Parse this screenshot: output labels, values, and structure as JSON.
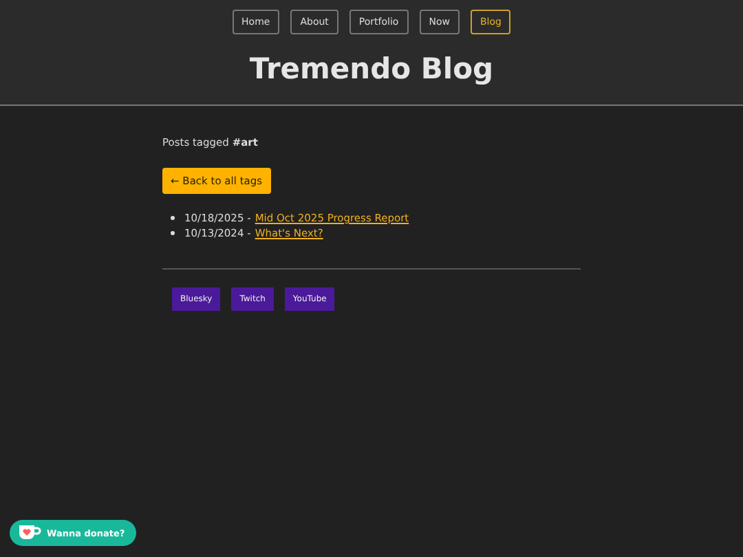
{
  "nav": [
    {
      "label": "Home",
      "selected": false
    },
    {
      "label": "About",
      "selected": false
    },
    {
      "label": "Portfolio",
      "selected": false
    },
    {
      "label": "Now",
      "selected": false
    },
    {
      "label": "Blog",
      "selected": true
    }
  ],
  "site_title": "Tremendo Blog",
  "heading": "Posts tagged **#art**",
  "back_button": "← Back to all tags",
  "posts": [
    {
      "date": "10/18/2025 -",
      "title": "Mid Oct 2025 Progress Report"
    },
    {
      "date": "10/13/2024 -",
      "title": "What's Next?"
    }
  ],
  "social_links": [
    "Bluesky",
    "Twitch",
    "YouTube"
  ],
  "donate_button": "Wanna donate?"
}
